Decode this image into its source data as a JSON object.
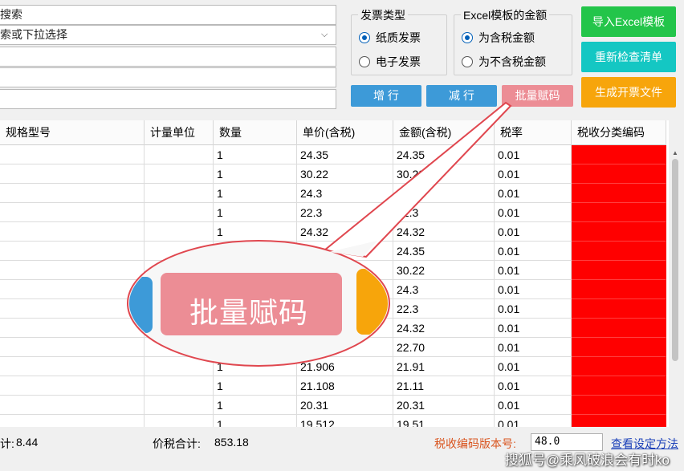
{
  "search": {
    "row1": "搜索",
    "row2": "索或下拉选择",
    "row3": "",
    "row4": "",
    "row5": ""
  },
  "invoice_type": {
    "title": "发票类型",
    "options": [
      "纸质发票",
      "电子发票"
    ],
    "selected": "纸质发票"
  },
  "amount_type": {
    "title": "Excel模板的金额",
    "options": [
      "为含税金额",
      "为不含税金额"
    ],
    "selected": "为含税金额"
  },
  "buttons": {
    "add_row": "增 行",
    "del_row": "减 行",
    "batch_code": "批量赋码",
    "import_excel": "导入Excel模板",
    "recheck": "重新检查清单",
    "generate": "生成开票文件"
  },
  "table": {
    "headers": [
      "规格型号",
      "计量单位",
      "数量",
      "单价(含税)",
      "金额(含税)",
      "税率",
      "税收分类编码"
    ],
    "rows": [
      [
        "",
        "",
        "1",
        "24.35",
        "24.35",
        "0.01",
        ""
      ],
      [
        "",
        "",
        "1",
        "30.22",
        "30.22",
        "0.01",
        ""
      ],
      [
        "",
        "",
        "1",
        "24.3",
        "24.3",
        "0.01",
        ""
      ],
      [
        "",
        "",
        "1",
        "22.3",
        "22.3",
        "0.01",
        ""
      ],
      [
        "",
        "",
        "1",
        "24.32",
        "24.32",
        "0.01",
        ""
      ],
      [
        "",
        "",
        "",
        "",
        "24.35",
        "0.01",
        ""
      ],
      [
        "",
        "",
        "",
        "",
        "30.22",
        "0.01",
        ""
      ],
      [
        "",
        "",
        "",
        "",
        "24.3",
        "0.01",
        ""
      ],
      [
        "",
        "",
        "",
        "",
        "22.3",
        "0.01",
        ""
      ],
      [
        "",
        "",
        "",
        "",
        "24.32",
        "0.01",
        ""
      ],
      [
        "",
        "",
        "",
        "",
        "22.70",
        "0.01",
        ""
      ],
      [
        "",
        "",
        "1",
        "21.906",
        "21.91",
        "0.01",
        ""
      ],
      [
        "",
        "",
        "1",
        "21.108",
        "21.11",
        "0.01",
        ""
      ],
      [
        "",
        "",
        "1",
        "20.31",
        "20.31",
        "0.01",
        ""
      ],
      [
        "",
        "",
        "1",
        "19.512",
        "19.51",
        "0.01",
        ""
      ]
    ]
  },
  "footer": {
    "tax_total_label": "计:",
    "tax_total_value": "8.44",
    "grand_total_label": "价税合计:",
    "grand_total_value": "853.18",
    "version_label": "税收编码版本号:",
    "version_value": "48.0",
    "help_link": "查看设定方法",
    "watermark": "搜狐号@乘风破浪会有时ko"
  },
  "callout": {
    "label": "批量赋码"
  },
  "colors": {
    "code_cell": "#ff0000",
    "callout_border": "#e0474f",
    "batch_button": "#ec8d95"
  }
}
